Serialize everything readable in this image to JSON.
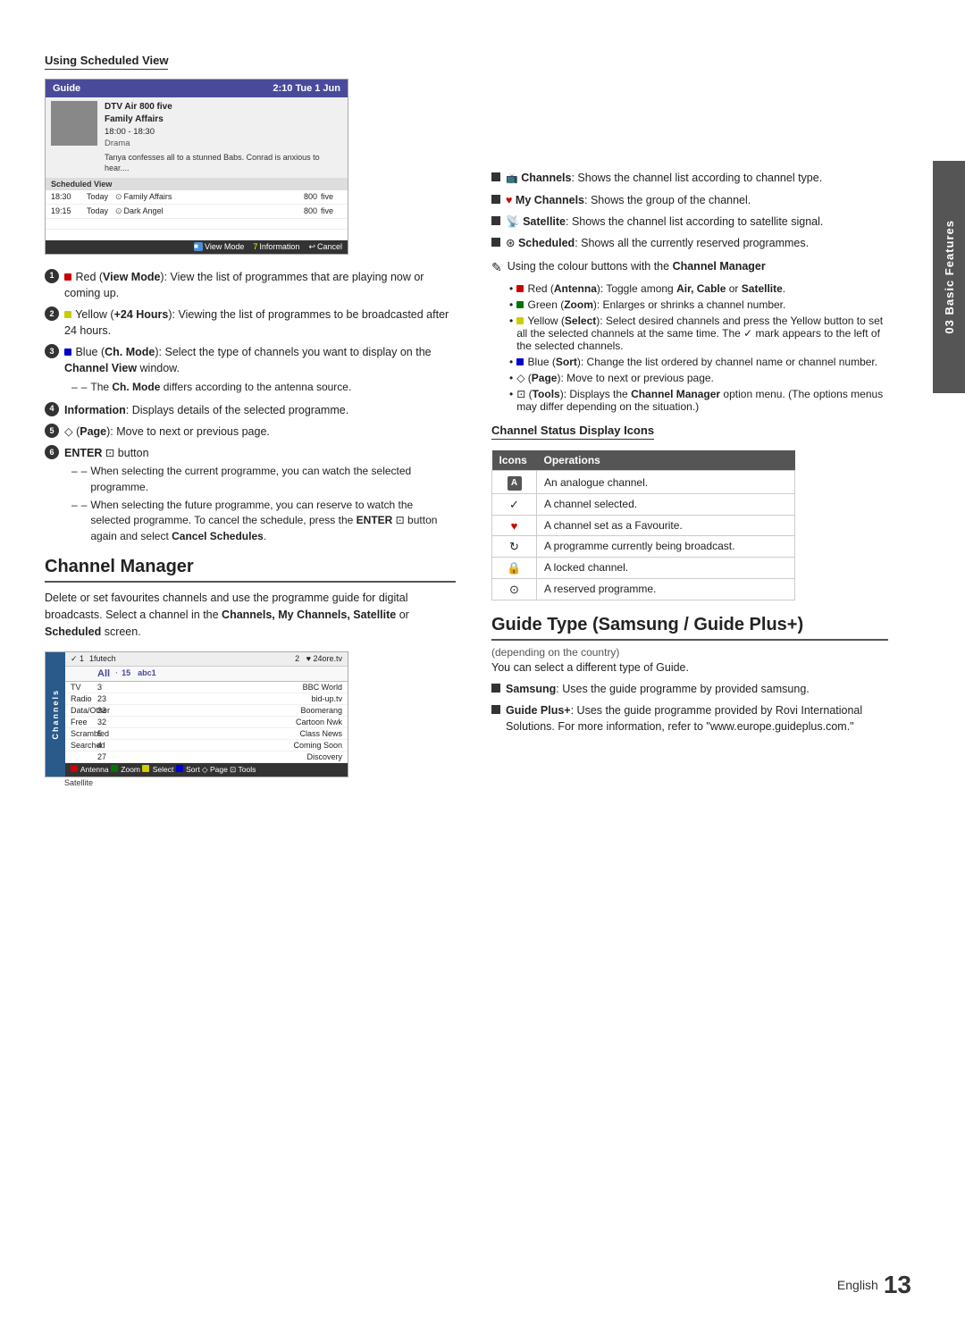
{
  "page": {
    "side_tab": "03 Basic Features",
    "footer_english": "English",
    "footer_num": "13"
  },
  "left": {
    "scheduled_view_heading": "Using Scheduled View",
    "guide_title": "Guide",
    "guide_time": "2:10 Tue 1 Jun",
    "guide_channel": "DTV Air 800 five",
    "guide_prog": "Family Affairs",
    "guide_time_range": "18:00 - 18:30",
    "guide_genre": "Drama",
    "guide_desc": "Tanya confesses all to a stunned Babs. Conrad is anxious to hear....",
    "guide_sched_label": "Scheduled View",
    "guide_row1_time": "18:30",
    "guide_row1_day": "Today",
    "guide_row1_prog": "Family Affairs",
    "guide_row1_num": "800",
    "guide_row1_ch": "five",
    "guide_row2_time": "19:15",
    "guide_row2_day": "Today",
    "guide_row2_prog": "Dark Angel",
    "guide_row2_num": "800",
    "guide_row2_ch": "five",
    "guide_btn_view": "View Mode",
    "guide_btn_info": "Information",
    "guide_btn_cancel": "Cancel",
    "items": [
      {
        "num": "1",
        "text": "Red (View Mode): View the list of programmes that are playing now or coming up."
      },
      {
        "num": "2",
        "text": "Yellow (+24 Hours): Viewing the list of programmes to be broadcasted after 24 hours."
      },
      {
        "num": "3",
        "text": "Blue (Ch. Mode): Select the type of channels you want to display on the Channel View window.",
        "sub": "The Ch. Mode differs according to the antenna source."
      },
      {
        "num": "4",
        "text": "Information: Displays details of the selected programme."
      },
      {
        "num": "5",
        "text": "(Page): Move to next or previous page."
      },
      {
        "num": "6",
        "text": "ENTER  button",
        "subs": [
          "When selecting the current programme, you can watch the selected programme.",
          "When selecting the future programme, you can reserve to watch the selected programme. To cancel the schedule, press the ENTER  button again and select Cancel Schedules."
        ]
      }
    ],
    "channel_manager_title": "Channel Manager",
    "channel_manager_desc": "Delete or set favourites channels and use the programme guide for digital broadcasts. Select a channel in the Channels, My Channels, Satellite or Scheduled screen.",
    "ch_header_check": "✓ 1",
    "ch_header_1futech": "1futech",
    "ch_header_num2": "2",
    "ch_header_24ore": "♥ 24ore.tv",
    "ch_all": "All",
    "ch_dot": "·",
    "ch_15": "15",
    "ch_abc1": "abc1",
    "ch_categories": [
      {
        "name": "TV",
        "num": "3",
        "prog": "BBC World"
      },
      {
        "name": "Radio",
        "num": "23",
        "prog": "bid-up.tv"
      },
      {
        "name": "Data/Other",
        "num": "33",
        "prog": "Boomerang"
      },
      {
        "name": "Free",
        "num": "32",
        "prog": "Cartoon Nwk"
      },
      {
        "name": "Scrambled",
        "num": "5",
        "prog": "Class News"
      },
      {
        "name": "Searched",
        "num": "4",
        "prog": "Coming Soon"
      },
      {
        "name": "",
        "num": "27",
        "prog": "Discovery"
      }
    ],
    "ch_footer": "■ Antenna ■ Zoom ■ Select ■ Sort ◇ Page  ⊡ Tools",
    "ch_satellite": "Satellite"
  },
  "right": {
    "bullet_items": [
      {
        "icon": "📺",
        "text": "Channels: Shows the channel list according to channel type."
      },
      {
        "icon": "♥",
        "text": "My Channels: Shows the group of the channel."
      },
      {
        "icon": "📡",
        "text": "Satellite: Shows the channel list according to satellite signal."
      },
      {
        "icon": "⊛",
        "text": "Scheduled: Shows all the currently reserved programmes."
      }
    ],
    "colour_note": "Using the colour buttons with the Channel Manager",
    "colour_items": [
      "Red (Antenna): Toggle among Air, Cable or Satellite.",
      "Green (Zoom): Enlarges or shrinks a channel number.",
      "Yellow (Select): Select desired channels and press the Yellow button to set all the selected channels at the same time. The ✓ mark appears to the left of the selected channels.",
      "Blue (Sort): Change the list ordered by channel name or channel number.",
      "(Page): Move to next or previous page.",
      "(Tools): Displays the Channel Manager option menu. (The options menus may differ depending on the situation.)"
    ],
    "status_heading": "Channel Status Display Icons",
    "status_table_col1": "Icons",
    "status_table_col2": "Operations",
    "status_rows": [
      {
        "icon": "A",
        "desc": "An analogue channel."
      },
      {
        "icon": "✓",
        "desc": "A channel selected."
      },
      {
        "icon": "♥",
        "desc": "A channel set as a Favourite."
      },
      {
        "icon": "↻",
        "desc": "A programme currently being broadcast."
      },
      {
        "icon": "🔒",
        "desc": "A locked channel."
      },
      {
        "icon": "⊙",
        "desc": "A reserved programme."
      }
    ],
    "guide_type_title": "Guide Type (Samsung / Guide Plus+)",
    "guide_type_sub1": "(depending on the country)",
    "guide_type_sub2": "You can select a different type of Guide.",
    "guide_type_items": [
      {
        "label": "Samsung",
        "text": "Uses the guide programme by provided samsung."
      },
      {
        "label": "Guide Plus+",
        "text": "Uses the guide programme provided by Rovi International Solutions. For more information, refer to \"www.europe.guideplus.com.\""
      }
    ]
  }
}
